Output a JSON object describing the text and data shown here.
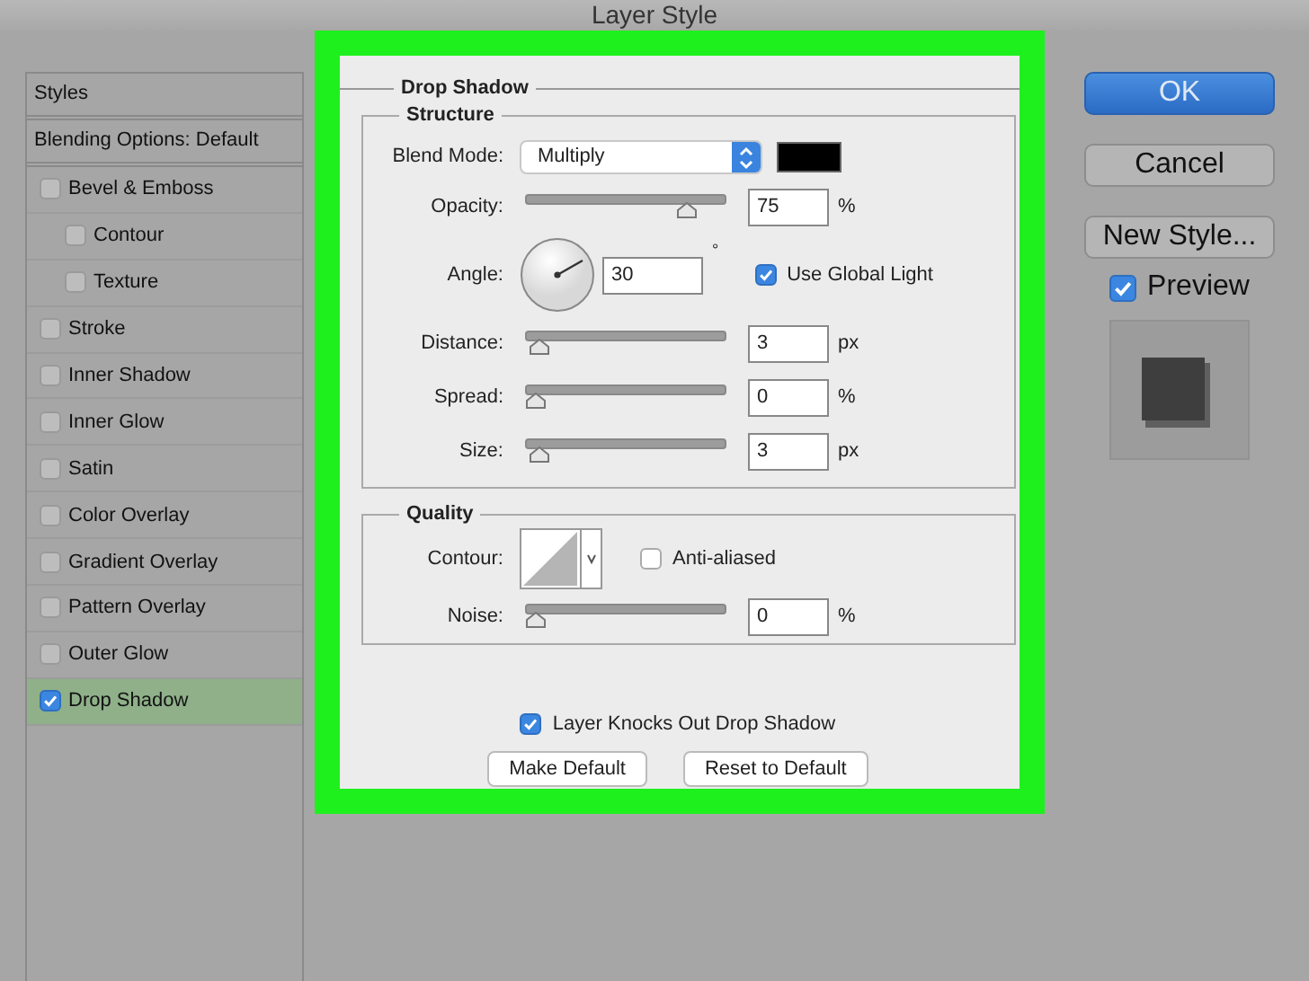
{
  "window": {
    "title": "Layer Style"
  },
  "sidebar": {
    "items": [
      {
        "kind": "header",
        "label": "Styles",
        "selected": false
      },
      {
        "kind": "header",
        "label": "Blending Options: Default",
        "selected": false
      },
      {
        "kind": "checkbox",
        "label": "Bevel & Emboss",
        "checked": false,
        "selected": false,
        "children": [
          {
            "kind": "checkbox",
            "label": "Contour",
            "checked": false,
            "selected": false
          },
          {
            "kind": "checkbox",
            "label": "Texture",
            "checked": false,
            "selected": false
          }
        ]
      },
      {
        "kind": "checkbox",
        "label": "Stroke",
        "checked": false,
        "selected": false
      },
      {
        "kind": "checkbox",
        "label": "Inner Shadow",
        "checked": false,
        "selected": false
      },
      {
        "kind": "checkbox",
        "label": "Inner Glow",
        "checked": false,
        "selected": false
      },
      {
        "kind": "checkbox",
        "label": "Satin",
        "checked": false,
        "selected": false
      },
      {
        "kind": "checkbox",
        "label": "Color Overlay",
        "checked": false,
        "selected": false
      },
      {
        "kind": "checkbox",
        "label": "Gradient Overlay",
        "checked": false,
        "selected": false
      },
      {
        "kind": "checkbox",
        "label": "Pattern Overlay",
        "checked": false,
        "selected": false
      },
      {
        "kind": "checkbox",
        "label": "Outer Glow",
        "checked": false,
        "selected": false
      },
      {
        "kind": "checkbox",
        "label": "Drop Shadow",
        "checked": true,
        "selected": true
      }
    ]
  },
  "drop_shadow": {
    "title": "Drop Shadow",
    "structure": {
      "title": "Structure",
      "rows": [
        {
          "kind": "select",
          "label": "Blend Mode:",
          "value": "Multiply"
        },
        {
          "kind": "slider",
          "label": "Opacity:",
          "level": 0.75,
          "value": "75",
          "unit": "%"
        },
        {
          "kind": "angle",
          "label": "Angle:",
          "value": "30",
          "unit": "°",
          "checkbox": {
            "label": "Use Global Light",
            "checked": true
          }
        },
        {
          "kind": "slider",
          "label": "Distance:",
          "level": 0.02,
          "value": "3",
          "unit": "px"
        },
        {
          "kind": "slider",
          "label": "Spread:",
          "level": 0,
          "value": "0",
          "unit": "%"
        },
        {
          "kind": "slider",
          "label": "Size:",
          "level": 0.02,
          "value": "3",
          "unit": "px"
        }
      ]
    },
    "quality": {
      "title": "Quality",
      "rows": [
        {
          "kind": "contour",
          "label": "Contour:",
          "checkbox": {
            "label": "Anti-aliased",
            "checked": false
          }
        },
        {
          "kind": "slider",
          "label": "Noise:",
          "level": 0,
          "value": "0",
          "unit": "%"
        }
      ]
    },
    "knockout": {
      "label": "Layer Knocks Out Drop Shadow",
      "checked": true
    },
    "buttons": [
      "Make Default",
      "Reset to Default"
    ]
  },
  "actions": {
    "buttons": [
      {
        "kind": "primary",
        "label": "OK"
      },
      {
        "kind": "normal",
        "label": "Cancel"
      },
      {
        "kind": "normal",
        "label": "New Style..."
      }
    ],
    "preview": {
      "label": "Preview",
      "checked": true
    }
  }
}
